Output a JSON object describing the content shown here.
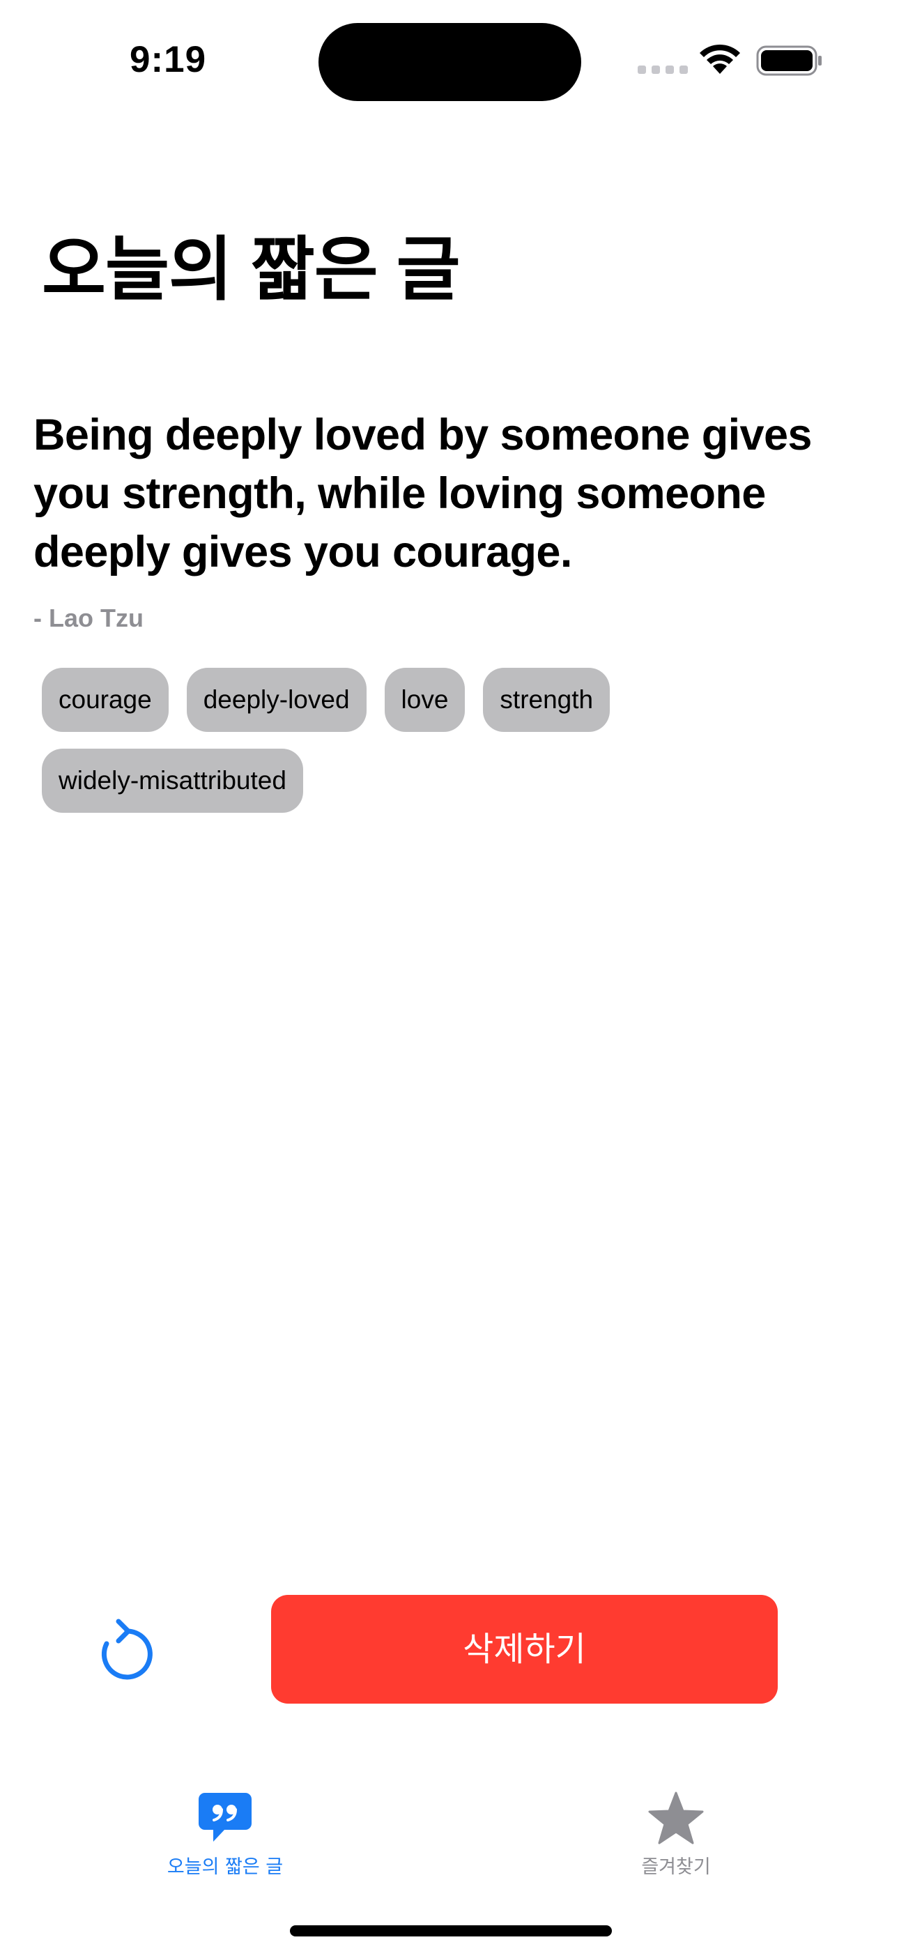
{
  "status_bar": {
    "time": "9:19"
  },
  "header": {
    "title": "오늘의 짧은 글"
  },
  "quote": {
    "text": "Being deeply loved by someone gives you strength, while loving someone deeply gives you courage.",
    "author": "- Lao Tzu",
    "tags": [
      "courage",
      "deeply-loved",
      "love",
      "strength",
      "widely-misattributed"
    ]
  },
  "actions": {
    "refresh_icon": "arrow-clockwise-icon",
    "delete_label": "삭제하기"
  },
  "tab_bar": {
    "tabs": [
      {
        "label": "오늘의 짧은 글",
        "icon": "quote-bubble-icon",
        "selected": true
      },
      {
        "label": "즐겨찾기",
        "icon": "star-icon",
        "selected": false
      }
    ]
  },
  "colors": {
    "accent": "#1a7cf5",
    "destructive": "#ff3b30",
    "tag_background": "#bdbdbf",
    "secondary_text": "#8e8e93"
  }
}
